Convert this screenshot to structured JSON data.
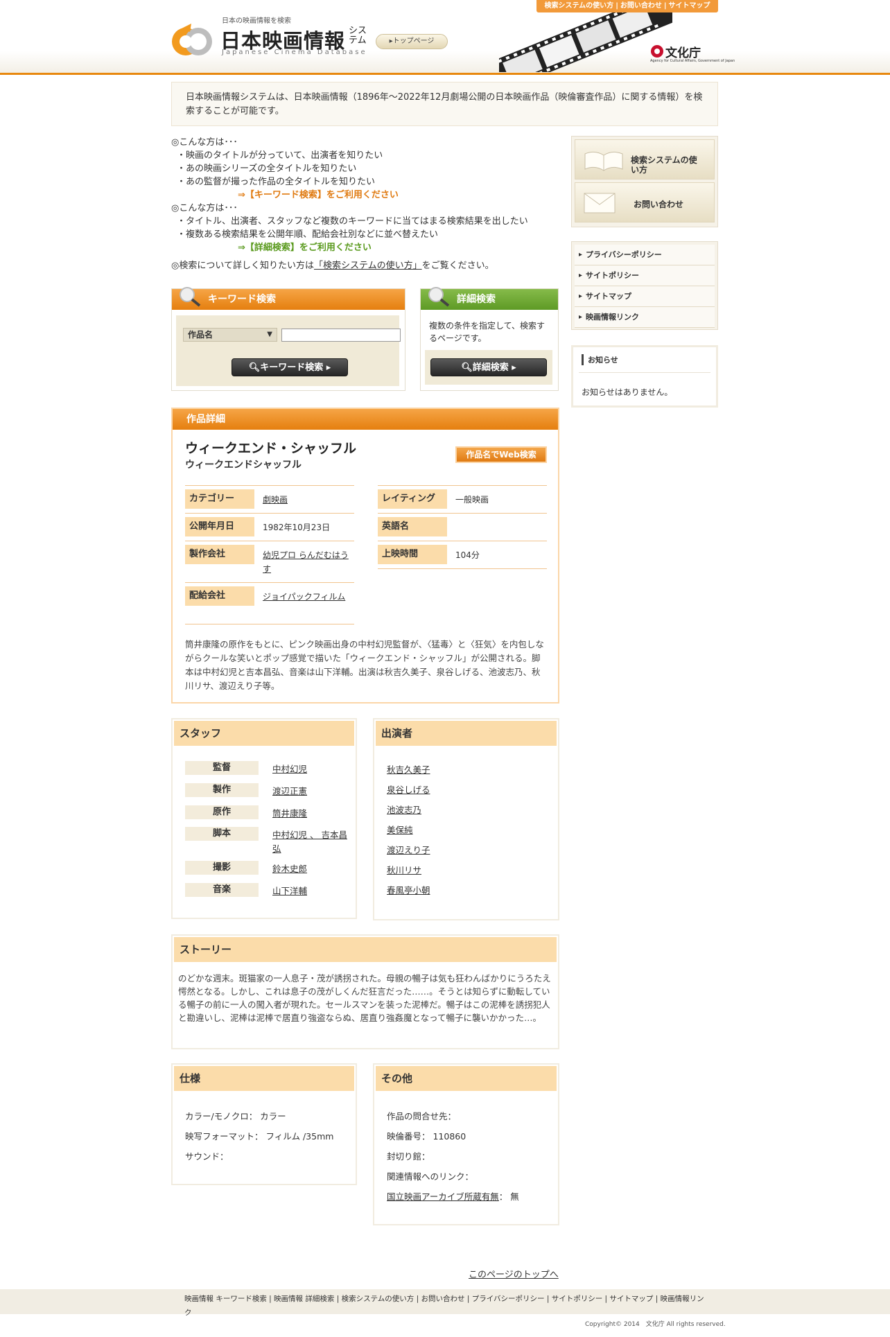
{
  "header": {
    "tagline": "日本の映画情報を検索",
    "title": "日本映画情報",
    "title_suffix": "システム",
    "subtitle_en": "Japanese Cinema Database",
    "top_page_button": "▸トップページ",
    "top_links": [
      "検索システムの使い方",
      "お問い合わせ",
      "サイトマップ"
    ],
    "agency_name": "文化庁",
    "agency_en": "Agency for Cultural Affairs, Government of Japan"
  },
  "intro": "日本映画情報システムは、日本映画情報（1896年～2022年12月劇場公開の日本映画作品（映倫審査作品）に関する情報）を検索することが可能です。",
  "info": {
    "case1_heading": "◎こんな方は･･･",
    "case1_items": [
      "・映画のタイトルが分っていて、出演者を知りたい",
      "・あの映画シリーズの全タイトルを知りたい",
      "・あの監督が撮った作品の全タイトルを知りたい"
    ],
    "case1_cta": "⇒【キーワード検索】をご利用ください",
    "case2_heading": "◎こんな方は･･･",
    "case2_items": [
      "・タイトル、出演者、スタッフなど複数のキーワードに当てはまる検索結果を出したい",
      "・複数ある検索結果を公開年順、配給会社別などに並べ替えたい"
    ],
    "case2_cta": "⇒【詳細検索】をご利用ください",
    "more_prefix": "◎検索について詳しく知りたい方は",
    "more_link": "「検索システムの使い方」",
    "more_suffix": "をご覧ください。"
  },
  "keyword_search": {
    "title": "キーワード検索",
    "select_value": "作品名",
    "input_value": "",
    "button": "キーワード検索 ▸"
  },
  "detail_search": {
    "title": "詳細検索",
    "description": "複数の条件を指定して、検索するページです。",
    "button": "詳細検索 ▸"
  },
  "sidebar": {
    "howto": "検索システムの使い方",
    "contact": "お問い合わせ",
    "links": [
      "プライバシーポリシー",
      "サイトポリシー",
      "サイトマップ",
      "映画情報リンク"
    ],
    "news_title": "お知らせ",
    "news_text": "お知らせはありません。"
  },
  "detail": {
    "section_title": "作品詳細",
    "title": "ウィークエンド・シャッフル",
    "title_kana": "ウィークエンドシャッフル",
    "web_search_button": "作品名でWeb検索",
    "left_fields": [
      {
        "key": "カテゴリー",
        "value": "劇映画"
      },
      {
        "key": "公開年月日",
        "value": "1982年10月23日"
      },
      {
        "key": "製作会社",
        "value": "幼児プロ らんだむはうす"
      },
      {
        "key": "配給会社",
        "value": "ジョイパックフィルム"
      }
    ],
    "right_fields": [
      {
        "key": "レイティング",
        "value": "一般映画"
      },
      {
        "key": "英語名",
        "value": ""
      },
      {
        "key": "上映時間",
        "value": "104分"
      }
    ],
    "synopsis": "筒井康隆の原作をもとに、ピンク映画出身の中村幻児監督が、〈猛毒〉と〈狂気〉を内包しながらクールな笑いとポップ感覚で描いた「ウィークエンド・シャッフル」が公開される。脚本は中村幻児と吉本昌弘、音楽は山下洋輔。出演は秋吉久美子、泉谷しげる、池波志乃、秋川リサ、渡辺えり子等。"
  },
  "staff": {
    "title": "スタッフ",
    "rows": [
      {
        "role": "監督",
        "names": "中村幻児"
      },
      {
        "role": "製作",
        "names": "渡辺正憲"
      },
      {
        "role": "原作",
        "names": "筒井康隆"
      },
      {
        "role": "脚本",
        "names": "中村幻児 、 吉本昌弘"
      },
      {
        "role": "撮影",
        "names": "鈴木史郎"
      },
      {
        "role": "音楽",
        "names": "山下洋輔"
      }
    ]
  },
  "cast": {
    "title": "出演者",
    "names": [
      "秋吉久美子",
      "泉谷しげる",
      "池波志乃",
      "美保純",
      "渡辺えり子",
      "秋川リサ",
      "春風亭小朝"
    ]
  },
  "story": {
    "title": "ストーリー",
    "text": "のどかな週末。斑猫家の一人息子・茂が誘拐された。母親の暢子は気も狂わんばかりにうろたえ愕然となる。しかし、これは息子の茂がしくんだ狂言だった……。そうとは知らずに動転している暢子の前に一人の闖入者が現れた。セールスマンを装った泥棒だ。暢子はこの泥棒を誘拐犯人と勘違いし、泥棒は泥棒で居直り強盗ならぬ、居直り強姦魔となって暢子に襲いかかった…。"
  },
  "spec": {
    "title": "仕様",
    "lines": [
      "カラー/モノクロ： カラー",
      "映写フォーマット： フィルム /35mm",
      "サウンド："
    ]
  },
  "other": {
    "title": "その他",
    "lines": [
      "作品の問合せ先：",
      "映倫番号： 110860",
      "封切り館：",
      "関連情報へのリンク："
    ],
    "archive_link": "国立映画アーカイブ所蔵有無",
    "archive_value": "： 無"
  },
  "footer": {
    "to_top": "このページのトップへ",
    "links": "映画情報 キーワード検索 | 映画情報 詳細検索 | 検索システムの使い方 | お問い合わせ | プライバシーポリシー | サイトポリシー | サイトマップ | 映画情報リンク",
    "copyright": "Copyright© 2014　文化庁 All rights reserved."
  },
  "colors": {
    "accent_orange": "#e57f0f",
    "accent_green": "#5e9a25",
    "label_bg": "#fbdcaa"
  }
}
